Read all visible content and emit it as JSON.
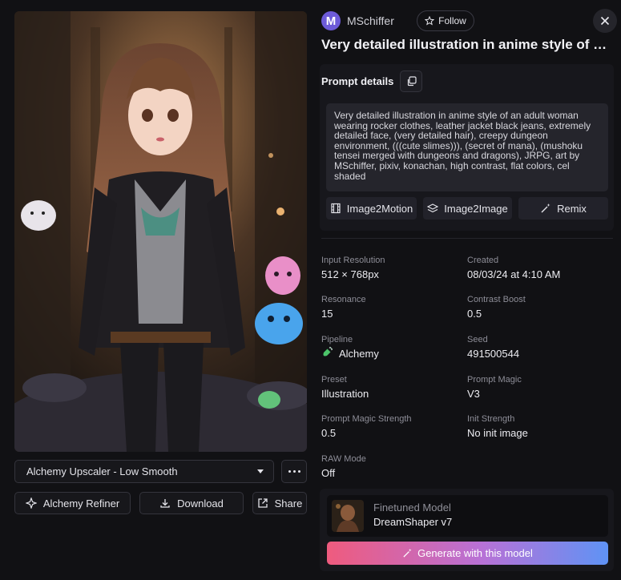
{
  "author": {
    "initial": "M",
    "name": "MSchiffer",
    "follow_label": "Follow"
  },
  "title": "Very detailed illustration in anime style of an...",
  "prompt": {
    "heading": "Prompt details",
    "text": "Very detailed illustration in anime style of an adult woman wearing rocker clothes, leather jacket black jeans, extremely detailed face, (very detailed hair), creepy dungeon environment, (((cute slimes))), (secret of mana), (mushoku tensei merged with dungeons and dragons), JRPG, art by MSchiffer, pixiv, konachan, high contrast, flat colors, cel shaded"
  },
  "tools": {
    "image2motion": "Image2Motion",
    "image2image": "Image2Image",
    "remix": "Remix"
  },
  "details": {
    "input_resolution": {
      "label": "Input Resolution",
      "value": "512 × 768px"
    },
    "created": {
      "label": "Created",
      "value": "08/03/24 at 4:10 AM"
    },
    "resonance": {
      "label": "Resonance",
      "value": "15"
    },
    "contrast_boost": {
      "label": "Contrast Boost",
      "value": "0.5"
    },
    "pipeline": {
      "label": "Pipeline",
      "value": "Alchemy"
    },
    "seed": {
      "label": "Seed",
      "value": "491500544"
    },
    "preset": {
      "label": "Preset",
      "value": "Illustration"
    },
    "prompt_magic": {
      "label": "Prompt Magic",
      "value": "V3"
    },
    "prompt_magic_strength": {
      "label": "Prompt Magic Strength",
      "value": "0.5"
    },
    "init_strength": {
      "label": "Init Strength",
      "value": "No init image"
    },
    "raw_mode": {
      "label": "RAW Mode",
      "value": "Off"
    }
  },
  "model": {
    "heading": "Finetuned Model",
    "name": "DreamShaper v7",
    "generate_label": "Generate with this model"
  },
  "left": {
    "upscaler": "Alchemy Upscaler - Low Smooth",
    "refiner_label": "Alchemy Refiner",
    "download_label": "Download",
    "share_label": "Share"
  },
  "colors": {
    "accent_start": "#ef5b7e",
    "accent_end": "#5f93f5",
    "avatar": "#6d5bd8"
  },
  "icons": [
    "star-icon",
    "close-icon",
    "copy-icon",
    "film-icon",
    "layers-icon",
    "wand-icon",
    "potion-icon",
    "caret-down-icon",
    "more-icon",
    "sparkle-icon",
    "download-icon",
    "share-icon"
  ]
}
